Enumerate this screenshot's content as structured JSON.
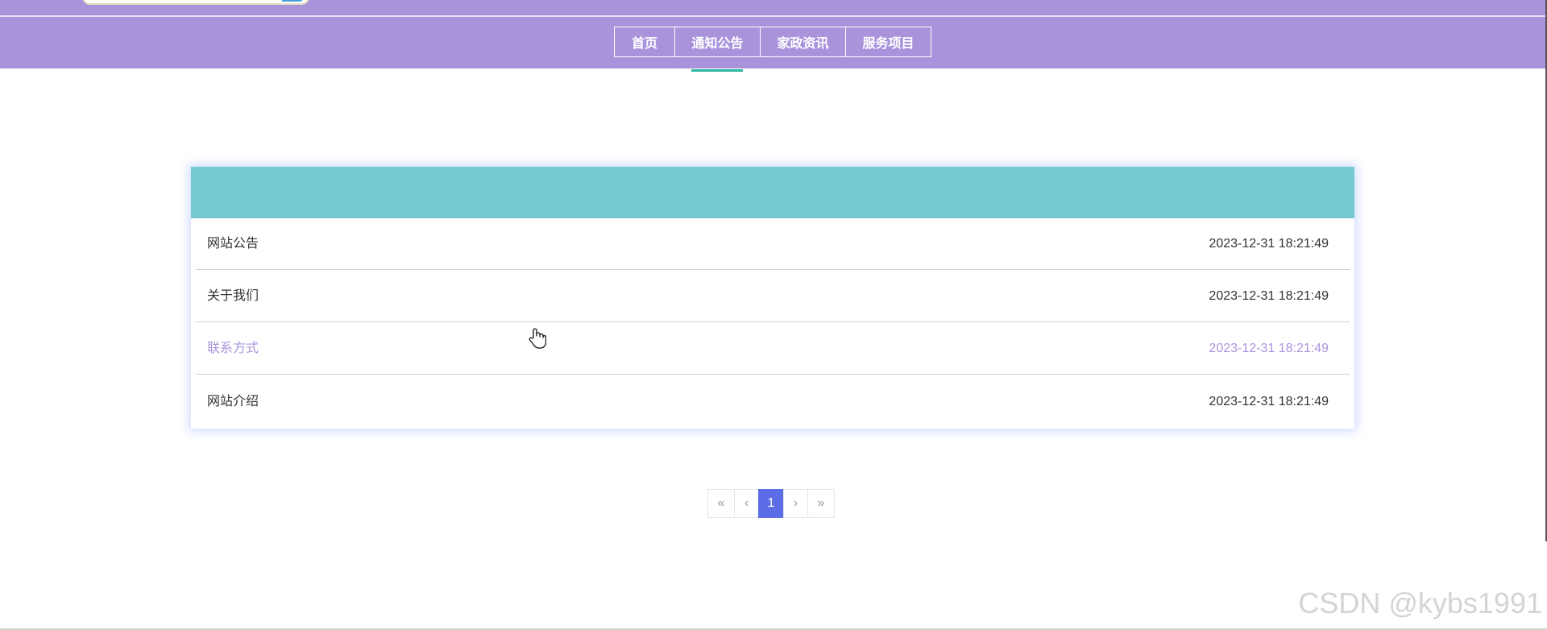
{
  "nav": {
    "items": [
      {
        "label": "首页"
      },
      {
        "label": "通知公告"
      },
      {
        "label": "家政资讯"
      },
      {
        "label": "服务项目"
      }
    ],
    "active": "通知公告"
  },
  "notices": [
    {
      "title": "网站公告",
      "date": "2023-12-31 18:21:49"
    },
    {
      "title": "关于我们",
      "date": "2023-12-31 18:21:49"
    },
    {
      "title": "联系方式",
      "date": "2023-12-31 18:21:49"
    },
    {
      "title": "网站介绍",
      "date": "2023-12-31 18:21:49"
    }
  ],
  "pagination": {
    "first": "«",
    "prev": "‹",
    "current": "1",
    "next": "›",
    "last": "»"
  },
  "watermark": "CSDN @kybs1991",
  "colors": {
    "header_purple": "#a994dc",
    "panel_teal": "#74cacf",
    "active_underline": "#2db7a0",
    "pager_active": "#5b6ee8",
    "hover_text": "#a994dc"
  }
}
